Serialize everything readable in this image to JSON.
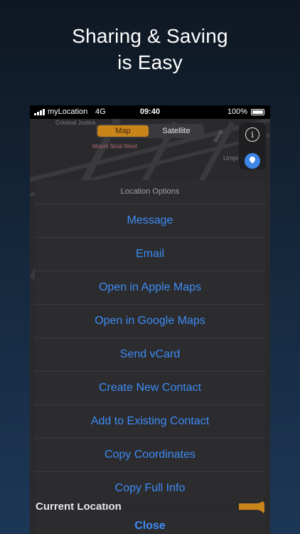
{
  "headline": {
    "line1": "Sharing & Saving",
    "line2": "is Easy"
  },
  "statusbar": {
    "carrier": "myLocation",
    "network": "4G",
    "time": "09:40",
    "battery": "100%"
  },
  "map": {
    "labels": {
      "top_left": "Criminal Justice",
      "poi": "Mount Sinai West",
      "street": "West",
      "right": "Umpi"
    },
    "segmented": {
      "map_label": "Map",
      "satellite_label": "Satellite"
    }
  },
  "sheet": {
    "title": "Location Options",
    "options": [
      "Message",
      "Email",
      "Open in Apple Maps",
      "Open in Google Maps",
      "Send vCard",
      "Create New Contact",
      "Add to Existing Contact",
      "Copy Coordinates",
      "Copy Full Info"
    ]
  },
  "current_location": "Current Location",
  "close_label": "Close",
  "colors": {
    "accent": "#3d8bf5",
    "map_segment": "#c9851a"
  }
}
